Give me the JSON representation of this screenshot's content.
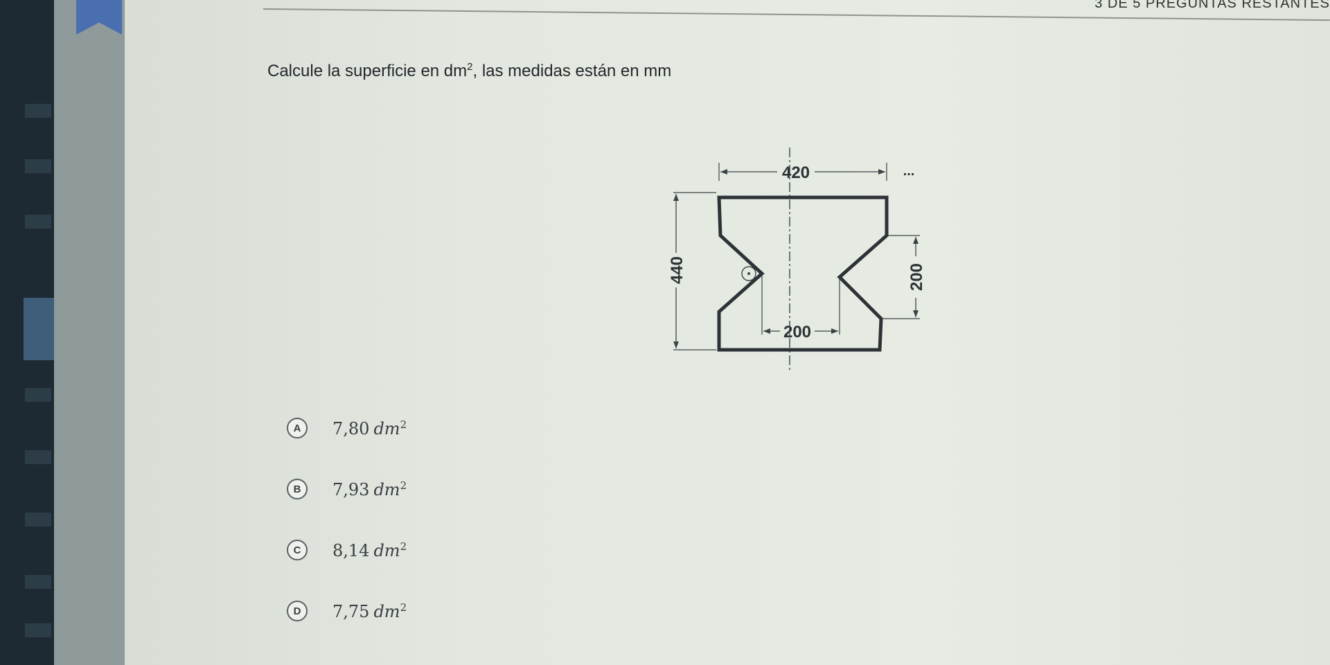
{
  "header": {
    "remaining_text": "3 DE 5 PREGUNTAS RESTANTES"
  },
  "question": {
    "text_before": "Calcule la superficie en dm",
    "text_exponent": "2",
    "text_after": ", las medidas están en mm"
  },
  "figure": {
    "dim_top": "420",
    "dim_left": "440",
    "dim_right": "200",
    "dim_inner": "200",
    "more_button": "..."
  },
  "options": [
    {
      "letter": "A",
      "value": "7,80",
      "unit": "dm",
      "exponent": "2"
    },
    {
      "letter": "B",
      "value": "7,93",
      "unit": "dm",
      "exponent": "2"
    },
    {
      "letter": "C",
      "value": "8,14",
      "unit": "dm",
      "exponent": "2"
    },
    {
      "letter": "D",
      "value": "7,75",
      "unit": "dm",
      "exponent": "2"
    }
  ]
}
